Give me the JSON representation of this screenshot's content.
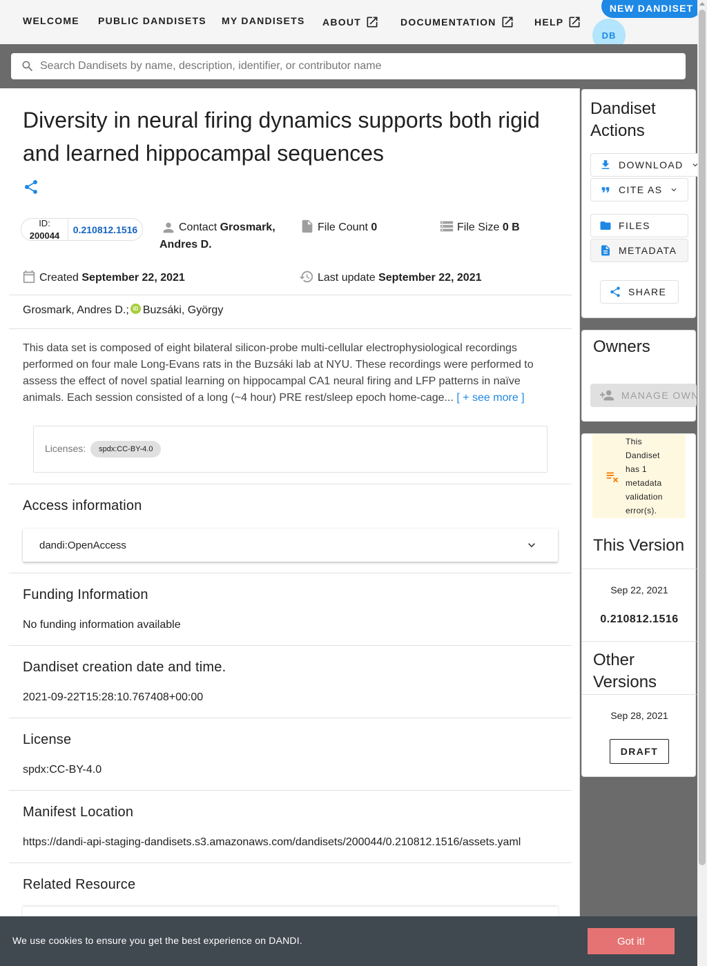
{
  "nav": {
    "welcome": "WELCOME",
    "public_dandisets": "PUBLIC DANDISETS",
    "my_dandisets": "MY DANDISETS",
    "about": "ABOUT",
    "documentation": "DOCUMENTATION",
    "help": "HELP",
    "new_dandiset": "NEW DANDISET",
    "avatar_initials": "DB"
  },
  "search": {
    "placeholder": "Search Dandisets by name, description, identifier, or contributor name"
  },
  "dandiset": {
    "title": "Diversity in neural firing dynamics supports both rigid and learned hippocampal sequences",
    "id_label": "ID:",
    "id": "200044",
    "version": "0.210812.1516",
    "contact_label": "Contact",
    "contact_line1": "Grosmark,",
    "contact_line2": "Andres D.",
    "file_count_label": "File Count",
    "file_count": "0",
    "file_size_label": "File Size",
    "file_size": "0 B",
    "created_label": "Created",
    "created": "September 22, 2021",
    "updated_label": "Last update",
    "updated": "September 22, 2021",
    "contributor1": "Grosmark, Andres D.;",
    "contributor2": "Buzsáki, György",
    "description": "This data set is composed of eight bilateral silicon-probe multi-cellular electrophysiological recordings performed on four male Long-Evans rats in the Buzsáki lab at NYU. These recordings were performed to assess the effect of novel spatial learning on hippocampal CA1 neural firing and LFP patterns in naïve animals. Each session consisted of a long (~4 hour) PRE rest/sleep epoch home-cage...",
    "see_more": "[ + see more ]",
    "licenses_label": "Licenses:",
    "license_chip": "spdx:CC-BY-4.0"
  },
  "sections": {
    "access_title": "Access information",
    "access_value": "dandi:OpenAccess",
    "funding_title": "Funding Information",
    "funding_value": "No funding information available",
    "creation_title": "Dandiset creation date and time.",
    "creation_value": "2021-09-22T15:28:10.767408+00:00",
    "license_title": "License",
    "license_value": "spdx:CC-BY-4.0",
    "manifest_title": "Manifest Location",
    "manifest_value": "https://dandi-api-staging-dandisets.s3.amazonaws.com/dandisets/200044/0.210812.1516/assets.yaml",
    "related_title": "Related Resource"
  },
  "sidebar": {
    "actions_title_1": "Dandiset",
    "actions_title_2": "Actions",
    "download": "DOWNLOAD",
    "cite_as": "CITE AS",
    "files": "FILES",
    "metadata": "METADATA",
    "share": "SHARE",
    "owners_title": "Owners",
    "manage_owners": "MANAGE OWNERS",
    "validation_message": "This Dandiset has 1 metadata validation error(s).",
    "this_version_title": "This Version",
    "this_version_date": "Sep 22, 2021",
    "this_version_number": "0.210812.1516",
    "other_versions_title_1": "Other",
    "other_versions_title_2": "Versions",
    "other_version_date": "Sep 28, 2021",
    "draft": "DRAFT"
  },
  "cookie": {
    "message": "We use cookies to ensure you get the best experience on DANDI.",
    "accept": "Got it!"
  },
  "colors": {
    "primary": "#1e88e5",
    "cookie_bg": "#404850",
    "cookie_btn": "#e57373",
    "warning_bg": "#fff8e1",
    "orcid": "#a6ce39"
  }
}
